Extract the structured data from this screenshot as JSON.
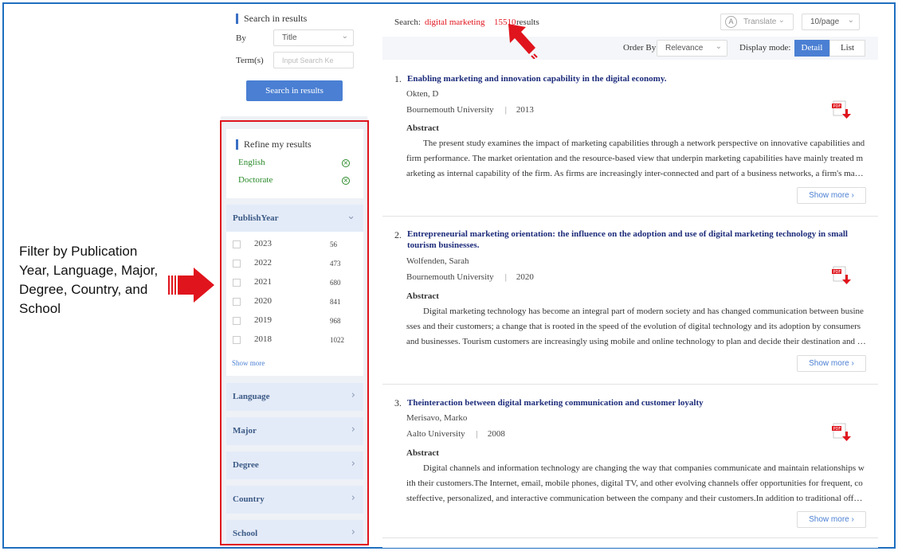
{
  "annotation": {
    "text": "Filter by Publication Year, Language, Major, Degree, Country, and School"
  },
  "search_panel": {
    "title": "Search in results",
    "by_label": "By",
    "by_value": "Title",
    "term_label": "Term(s)",
    "term_placeholder": "Input Search Ke",
    "button": "Search in results"
  },
  "refine": {
    "title": "Refine my results",
    "items": [
      {
        "label": "English"
      },
      {
        "label": "Doctorate"
      }
    ]
  },
  "facets": {
    "publish_year": {
      "label": "PublishYear",
      "years": [
        {
          "year": "2023",
          "count": "56"
        },
        {
          "year": "2022",
          "count": "473"
        },
        {
          "year": "2021",
          "count": "680"
        },
        {
          "year": "2020",
          "count": "841"
        },
        {
          "year": "2019",
          "count": "968"
        },
        {
          "year": "2018",
          "count": "1022"
        }
      ],
      "show_more": "Show more"
    },
    "others": [
      {
        "label": "Language"
      },
      {
        "label": "Major"
      },
      {
        "label": "Degree"
      },
      {
        "label": "Country"
      },
      {
        "label": "School"
      }
    ]
  },
  "header": {
    "search_label": "Search:",
    "query": "digital marketing",
    "count": "15510",
    "results_label": "results",
    "translate": "Translate",
    "per_page": "10/page",
    "order_by_label": "Order By",
    "order_by_value": "Relevance",
    "display_mode_label": "Display mode:",
    "detail": "Detail",
    "list": "List"
  },
  "results": [
    {
      "num": "1.",
      "title": "Enabling marketing and innovation capability in the digital economy.",
      "author": "Okten, D",
      "school": "Bournemouth University",
      "year": "2013",
      "abstract_label": "Abstract",
      "abstract": "The present study examines the impact of marketing capabilities through a network perspective on innovative capabilities and firm performance. The market orientation and the resource-based view that underpin marketing capabilities have mainly treated marketing as internal capability of the firm. As firms are increasingly inter-connected and part of a business networks, a firm's marketing capabilities need to be understood in a networked context.",
      "show_more": "Show more"
    },
    {
      "num": "2.",
      "title": "Entrepreneurial marketing orientation: the influence on the adoption and use of digital marketing technology in small tourism businesses.",
      "author": "Wolfenden, Sarah",
      "school": "Bournemouth University",
      "year": "2020",
      "abstract_label": "Abstract",
      "abstract": "Digital marketing technology has become an integral part of modern society and has changed communication between businesses and their customers; a change that is rooted in the speed of the evolution of digital technology and its adoption by consumers and businesses. Tourism customers are increasingly using mobile and online technology to plan and decide their destination and accommodation. As a result, tourism businesses must adapt.",
      "show_more": "Show more"
    },
    {
      "num": "3.",
      "title": "Theinteraction between digital marketing communication and customer loyalty",
      "author": "Merisavo, Marko",
      "school": "Aalto University",
      "year": "2008",
      "abstract_label": "Abstract",
      "abstract": "Digital channels and information technology are changing the way that companies communicate and maintain relationships with their customers.The Internet, email, mobile phones, digital TV, and other evolving channels offer opportunities for frequent, costeffective, personalized, and interactive communication between the company and their customers.In addition to traditional offers and persuasion, customers value this contact.",
      "show_more": "Show more"
    }
  ],
  "colors": {
    "accent": "#4a7fd3",
    "highlight": "#e0141d",
    "title": "#1c2b7a",
    "refine": "#2a8a2a"
  }
}
